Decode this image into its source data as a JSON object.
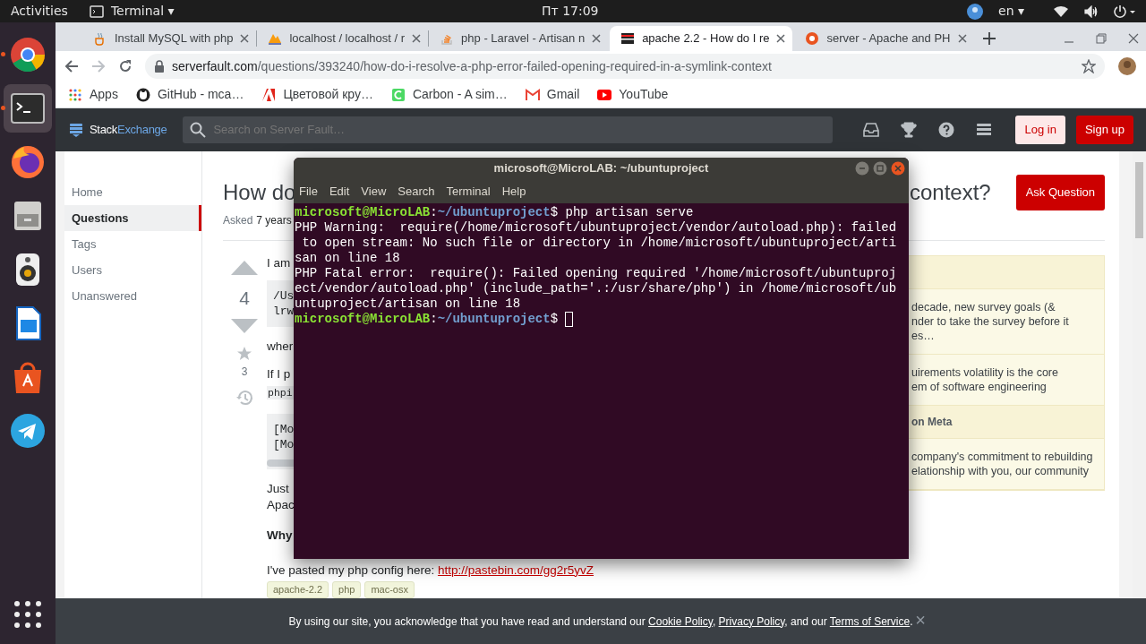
{
  "top_bar": {
    "activities": "Activities",
    "app_menu": "Terminal ▾",
    "clock": "Пт 17:09",
    "language": "en ▾"
  },
  "dock": [
    {
      "kind": "chrome",
      "running": true,
      "selected": false
    },
    {
      "kind": "terminal",
      "running": true,
      "selected": true
    },
    {
      "kind": "firefox",
      "running": false,
      "selected": false
    },
    {
      "kind": "files",
      "running": false,
      "selected": false
    },
    {
      "kind": "speaker",
      "running": false,
      "selected": false
    },
    {
      "kind": "writer",
      "running": false,
      "selected": false
    },
    {
      "kind": "software",
      "running": false,
      "selected": false
    },
    {
      "kind": "telegram",
      "running": false,
      "selected": false
    },
    {
      "kind": "apps",
      "running": false,
      "selected": false
    }
  ],
  "tabs": [
    {
      "title": "Install MySQL with php",
      "selected": false
    },
    {
      "title": "localhost / localhost / r",
      "selected": false
    },
    {
      "title": "php - Laravel - Artisan n",
      "selected": false
    },
    {
      "title": "apache 2.2 - How do I re",
      "selected": true
    },
    {
      "title": "server - Apache and PH",
      "selected": false
    }
  ],
  "address": {
    "domain": "serverfault.com",
    "path": "/questions/393240/how-do-i-resolve-a-php-error-failed-opening-required-in-a-symlink-context"
  },
  "bookmarks": [
    "Apps",
    "GitHub - mca…",
    "Цветовой кру…",
    "Carbon - A sim…",
    "Gmail",
    "YouTube"
  ],
  "site_header": {
    "brand_left": "Stack",
    "brand_right": "Exchange",
    "search_placeholder": "Search on Server Fault…",
    "login": "Log in",
    "signup": "Sign up"
  },
  "nav": [
    {
      "label": "Home",
      "selected": false
    },
    {
      "label": "Questions",
      "selected": true
    },
    {
      "label": "Tags",
      "selected": false
    },
    {
      "label": "Users",
      "selected": false
    },
    {
      "label": "Unanswered",
      "selected": false
    }
  ],
  "question": {
    "title_start": "How do",
    "title_end": "context?",
    "ask_button": "Ask Question",
    "asked_label": "Asked",
    "asked_value": "7 years",
    "votes": "4",
    "favorites": "3",
    "body": [
      {
        "kind": "text",
        "lines": [
          "I am"
        ]
      },
      {
        "kind": "code",
        "lines": [
          "/Us",
          "lrw"
        ],
        "scrollable": false
      },
      {
        "kind": "text",
        "lines": [
          "wher"
        ]
      },
      {
        "kind": "text",
        "lines": [
          "If I p"
        ]
      },
      {
        "kind": "inline_code",
        "lines": [
          "phpi"
        ]
      },
      {
        "kind": "code",
        "lines": [
          "[Mo",
          "[Mo"
        ],
        "scrollable": true
      },
      {
        "kind": "text",
        "lines": [
          "Just",
          "Apac"
        ]
      },
      {
        "kind": "bold",
        "lines": [
          "Why"
        ]
      },
      {
        "kind": "link_text",
        "text": "I've pasted my php config here:",
        "link": "http://pastebin.com/gg2r5yvZ"
      }
    ],
    "tags": [
      "apache-2.2",
      "php",
      "mac-osx"
    ]
  },
  "sidebar_box": [
    {
      "kind": "header"
    },
    {
      "kind": "item",
      "lines": [
        "decade, new survey goals (&",
        "nder to take the survey before it",
        "es…"
      ]
    },
    {
      "kind": "item",
      "lines": [
        "uirements volatility is the core",
        "em of software engineering"
      ]
    },
    {
      "kind": "header",
      "lines": [
        "on Meta"
      ]
    },
    {
      "kind": "item",
      "lines": [
        "company's commitment to rebuilding",
        "elationship with you, our community"
      ]
    }
  ],
  "terminal": {
    "title": "microsoft@MicroLAB: ~/ubuntuproject",
    "menu": [
      "File",
      "Edit",
      "View",
      "Search",
      "Terminal",
      "Help"
    ],
    "lines": [
      {
        "kind": "prompt",
        "user": "microsoft@MicroLAB",
        "sep": ":",
        "path": "~/ubuntuproject",
        "command": "$ php artisan serve"
      },
      {
        "kind": "output",
        "text": "PHP Warning:  require(/home/microsoft/ubuntuproject/vendor/autoload.php): failed"
      },
      {
        "kind": "output",
        "text": " to open stream: No such file or directory in /home/microsoft/ubuntuproject/arti"
      },
      {
        "kind": "output",
        "text": "san on line 18"
      },
      {
        "kind": "output",
        "text": "PHP Fatal error:  require(): Failed opening required '/home/microsoft/ubuntuproj"
      },
      {
        "kind": "output",
        "text": "ect/vendor/autoload.php' (include_path='.:/usr/share/php') in /home/microsoft/ub"
      },
      {
        "kind": "output",
        "text": "untuproject/artisan on line 18"
      },
      {
        "kind": "prompt",
        "user": "microsoft@MicroLAB",
        "sep": ":",
        "path": "~/ubuntuproject",
        "command": "$",
        "cursor": true
      }
    ]
  },
  "cookie_bar": {
    "parts": [
      {
        "kind": "text",
        "text": "By using our site, you acknowledge that you have read and understand our "
      },
      {
        "kind": "link",
        "text": "Cookie Policy"
      },
      {
        "kind": "text",
        "text": ", "
      },
      {
        "kind": "link",
        "text": "Privacy Policy"
      },
      {
        "kind": "text",
        "text": ", and our "
      },
      {
        "kind": "link",
        "text": "Terms of Service"
      },
      {
        "kind": "text",
        "text": "."
      }
    ],
    "close": "×"
  }
}
